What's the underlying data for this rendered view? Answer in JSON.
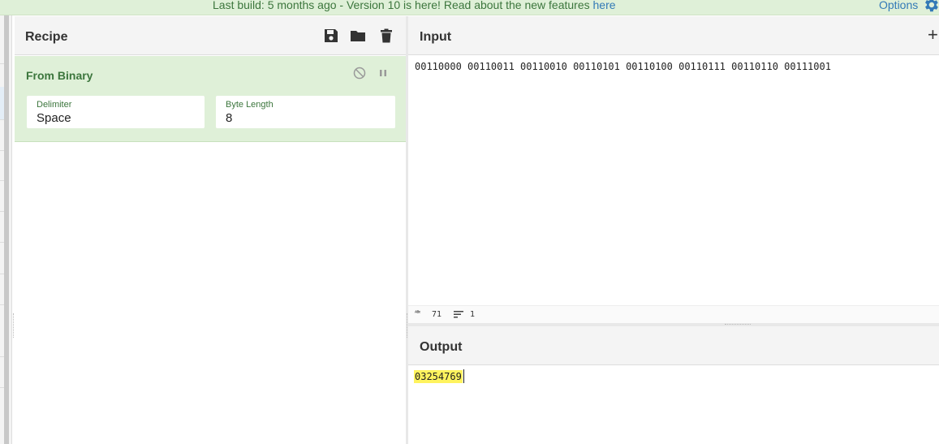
{
  "banner": {
    "message_prefix": "Last build: 5 months ago - Version 10 is here! Read about the new features ",
    "link_text": "here",
    "options_label": "Options",
    "gear_icon": "gear-icon"
  },
  "recipe": {
    "title": "Recipe",
    "icons": [
      "save-icon",
      "folder-icon",
      "trash-icon"
    ],
    "operation": {
      "name": "From Binary",
      "icons": [
        "disable-icon",
        "pause-icon"
      ],
      "fields": [
        {
          "label": "Delimiter",
          "value": "Space"
        },
        {
          "label": "Byte Length",
          "value": "8"
        }
      ]
    }
  },
  "input": {
    "title": "Input",
    "add_label": "+",
    "text": "00110000 00110011 00110010 00110101 00110100 00110111 00110110 00111001",
    "status": {
      "abc": "ᴬᴮᶜ",
      "char_count": "71",
      "line_count": "1"
    }
  },
  "output": {
    "title": "Output",
    "text": "03254769"
  },
  "colors": {
    "banner_bg": "#dff0d8",
    "op_bg": "#dff0d8",
    "op_text": "#3c763d",
    "link": "#337ab7",
    "highlight": "#fff35e"
  }
}
